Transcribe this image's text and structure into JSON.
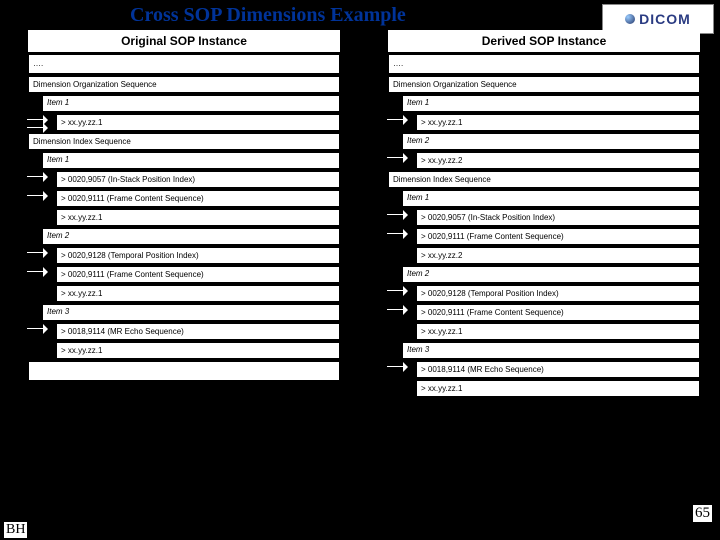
{
  "title": "Cross SOP Dimensions Example",
  "logo_text": "DICOM",
  "page_number": "65",
  "initials": "BH",
  "left": {
    "header": "Original SOP Instance",
    "ellipsis": "….",
    "dim_org_seq": "Dimension Organization Sequence",
    "item1": "Item 1",
    "uid1": "> xx.yy.zz.1",
    "dim_idx_seq": "Dimension Index Sequence",
    "di_item1": "Item 1",
    "r1a": "> 0020,9057 (In-Stack Position Index)",
    "r1b": "> 0020,9111 (Frame Content Sequence)",
    "r1c": "> xx.yy.zz.1",
    "di_item2": "Item 2",
    "r2a": "> 0020,9128 (Temporal Position Index)",
    "r2b": "> 0020,9111 (Frame Content Sequence)",
    "r2c": "> xx.yy.zz.1",
    "di_item3": "Item 3",
    "r3a": "> 0018,9114 (MR Echo Sequence)",
    "r3b": "> xx.yy.zz.1"
  },
  "right": {
    "header": "Derived SOP Instance",
    "ellipsis": "….",
    "dim_org_seq": "Dimension Organization Sequence",
    "item1": "Item 1",
    "uid1": "> xx.yy.zz.1",
    "item2": "Item 2",
    "uid2": "> xx.yy.zz.2",
    "dim_idx_seq": "Dimension Index Sequence",
    "di_item1": "Item 1",
    "r1a": "> 0020,9057 (In-Stack Position Index)",
    "r1b": "> 0020,9111 (Frame Content Sequence)",
    "r1c": "> xx.yy.zz.2",
    "di_item2": "Item 2",
    "r2a": "> 0020,9128 (Temporal Position Index)",
    "r2b": "> 0020,9111 (Frame Content Sequence)",
    "r2c": "> xx.yy.zz.1",
    "di_item3": "Item 3",
    "r3a": "> 0018,9114 (MR Echo Sequence)",
    "r3b": "> xx.yy.zz.1"
  }
}
